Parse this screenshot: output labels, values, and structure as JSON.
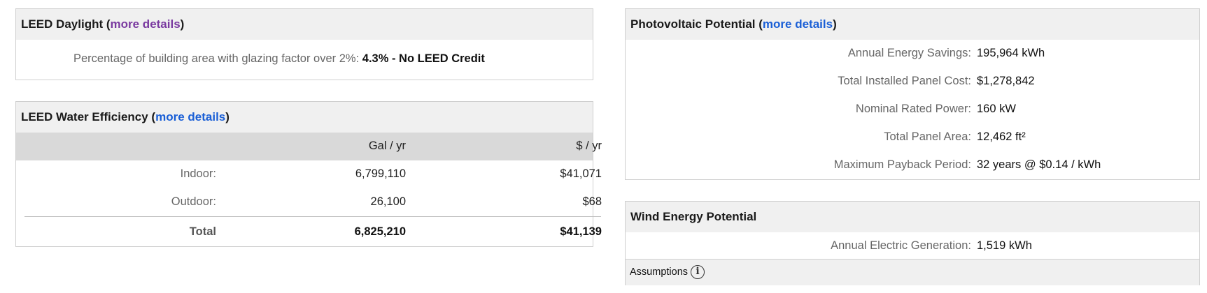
{
  "daylight": {
    "title": "LEED Daylight",
    "link": "more details",
    "text": "Percentage of building area with glazing factor over 2%:",
    "result": "4.3% - No LEED Credit"
  },
  "water": {
    "title": "LEED Water Efficiency",
    "link": "more details",
    "col_gal": "Gal / yr",
    "col_cost": "$ / yr",
    "rows": [
      {
        "label": "Indoor:",
        "gal": "6,799,110",
        "cost": "$41,071"
      },
      {
        "label": "Outdoor:",
        "gal": "26,100",
        "cost": "$68"
      }
    ],
    "total": {
      "label": "Total",
      "gal": "6,825,210",
      "cost": "$41,139"
    }
  },
  "pv": {
    "title": "Photovoltaic Potential",
    "link": "more details",
    "rows": [
      {
        "label": "Annual Energy Savings:",
        "value": "195,964 kWh"
      },
      {
        "label": "Total Installed Panel Cost:",
        "value": "$1,278,842"
      },
      {
        "label": "Nominal Rated Power:",
        "value": "160 kW"
      },
      {
        "label": "Total Panel Area:",
        "value": "12,462 ft²"
      },
      {
        "label": "Maximum Payback Period:",
        "value": "32 years @ $0.14 / kWh"
      }
    ]
  },
  "wind": {
    "title": "Wind Energy Potential",
    "label": "Annual Electric Generation:",
    "value": "1,519 kWh",
    "assumptions": "Assumptions",
    "info_icon": "info-icon"
  }
}
